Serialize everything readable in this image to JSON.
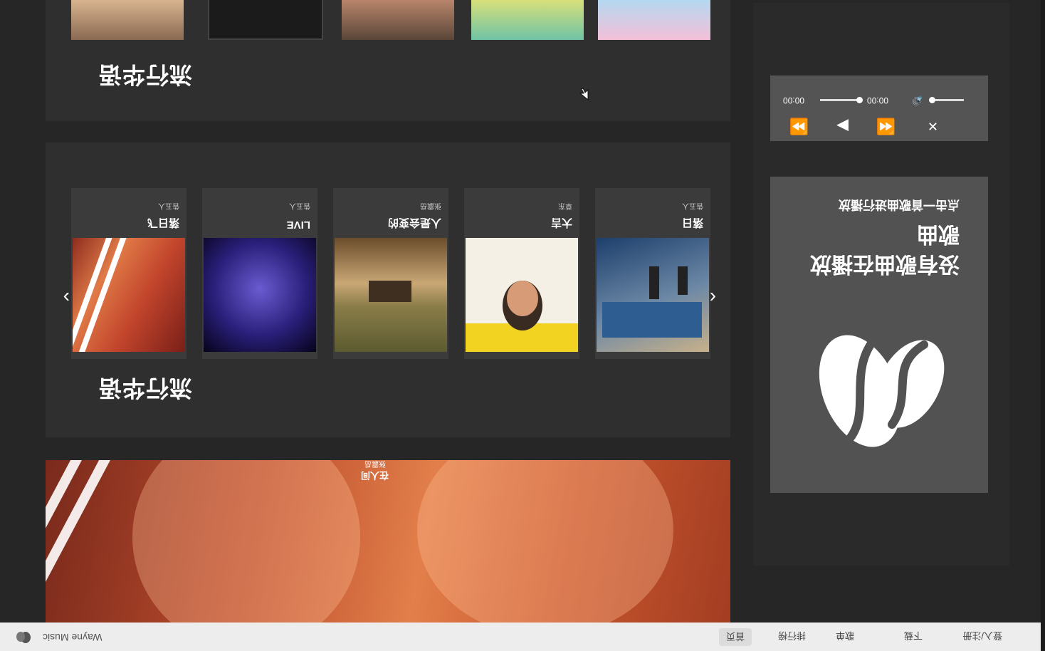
{
  "app": {
    "brand": "Wayne Music",
    "nav": [
      "首页",
      "排行榜",
      "歌单",
      "下载",
      "登入/注册"
    ]
  },
  "hero": {
    "caption_title": "在人间",
    "caption_artist": "张震岳"
  },
  "sections": [
    {
      "title": "流行华语",
      "cards": [
        {
          "title": "落日飞",
          "artist": "告五人",
          "art": "art-red-couple"
        },
        {
          "title": "LIVE",
          "artist": "告五人",
          "art": "art-blue-stage"
        },
        {
          "title": "人是会变的",
          "artist": "张震岳",
          "art": "art-room"
        },
        {
          "title": "大吉",
          "artist": "草东",
          "art": "art-face-yellow"
        },
        {
          "title": "落日",
          "artist": "告五人",
          "art": "art-pool"
        }
      ]
    },
    {
      "title": "流行华语",
      "cards": []
    }
  ],
  "now_playing": {
    "line1": "没有歌曲在播放",
    "line2": "歌曲",
    "line3": "点击一首歌曲进行播放"
  },
  "player": {
    "current_time": "00:00",
    "total_time": "00:00",
    "progress": 0,
    "volume": 1.0
  },
  "colors": {
    "background": "#262626",
    "section": "#2f2f2f",
    "card": "#3b3b3b",
    "panel": "#525252",
    "navbar": "#ededed"
  }
}
